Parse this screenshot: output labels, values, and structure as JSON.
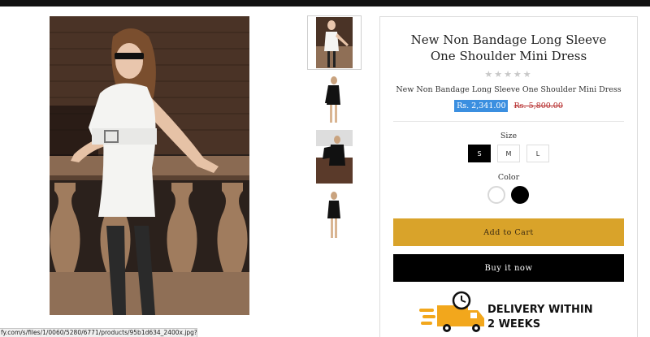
{
  "product": {
    "title": "New Non Bandage Long Sleeve One Shoulder Mini Dress",
    "rating_stars": "★★★★★",
    "subtitle": "New Non Bandage Long Sleeve One Shoulder Mini Dress",
    "price_sale": "Rs. 2,341.00",
    "price_compare": "Rs. 5,800.00"
  },
  "images": {
    "main_alt": "model-white-dress-photo",
    "thumbnails": [
      "white-dress-model",
      "black-dress-front",
      "black-dress-model",
      "black-dress-side"
    ],
    "active_thumbnail_index": 0
  },
  "options": {
    "size_label": "Size",
    "sizes": [
      "S",
      "M",
      "L"
    ],
    "selected_size": "S",
    "color_label": "Color",
    "colors": [
      "#ffffff",
      "#000000"
    ]
  },
  "actions": {
    "add_to_cart": "Add to Cart",
    "buy_now": "Buy it now"
  },
  "delivery": {
    "icon": "delivery-truck-clock-icon",
    "line1": "DELIVERY WITHIN",
    "line2": "2 WEEKS"
  },
  "browser": {
    "status_url": "fy.com/s/files/1/0060/5280/6771/products/95b1d634_2400x.jpg?..."
  },
  "colors": {
    "cart_button": "#d9a32a",
    "buy_button": "#000000",
    "sale_highlight": "#3b8fe0",
    "compare_price": "#b52a2a",
    "delivery_icon": "#f2a71c"
  }
}
